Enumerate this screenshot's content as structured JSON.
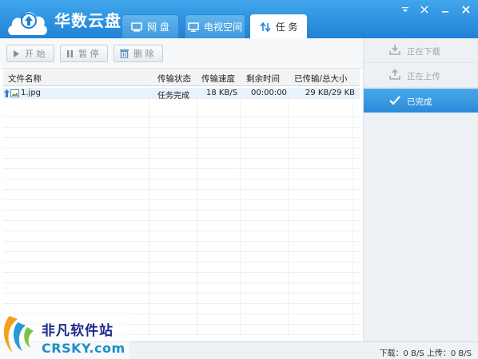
{
  "app": {
    "title": "华数云盘"
  },
  "tabs": [
    {
      "label": "网 盘",
      "icon": "drive-icon",
      "active": false
    },
    {
      "label": "电视空间",
      "icon": "tv-icon",
      "active": false
    },
    {
      "label": "任 务",
      "icon": "transfer-arrows-icon",
      "active": true
    }
  ],
  "window_controls": [
    {
      "name": "menu-dropdown-icon"
    },
    {
      "name": "skin-icon"
    },
    {
      "name": "minimize-icon"
    },
    {
      "name": "close-icon"
    }
  ],
  "toolbar": {
    "start": "开 始",
    "pause": "暂 停",
    "delete": "删 除"
  },
  "table": {
    "headers": [
      "文件名称",
      "传输状态",
      "传输速度",
      "剩余时间",
      "已传输/总大小"
    ],
    "rows": [
      {
        "direction_icon": "upload-arrow-icon",
        "file_icon": "image-file-icon",
        "name": "1.jpg",
        "status": "任务完成",
        "speed": "18 KB/S",
        "remaining": "00:00:00",
        "transferred": "29 KB/29 KB",
        "selected": true
      }
    ]
  },
  "sidebar": {
    "items": [
      {
        "label": "正在下载",
        "icon": "download-tray-icon",
        "active": false
      },
      {
        "label": "正在上传",
        "icon": "upload-tray-icon",
        "active": false
      },
      {
        "label": "已完成",
        "icon": "checkmark-icon",
        "active": true
      }
    ]
  },
  "status": {
    "download": "下载：0 B/S",
    "upload": "上传：0 B/S"
  },
  "watermark": {
    "title": "非凡软件站",
    "url": "CRSKY.com"
  },
  "colors": {
    "header": "#2a8bdb",
    "active_side": "#3a9be2",
    "selected_row": "#e7f2fc"
  }
}
